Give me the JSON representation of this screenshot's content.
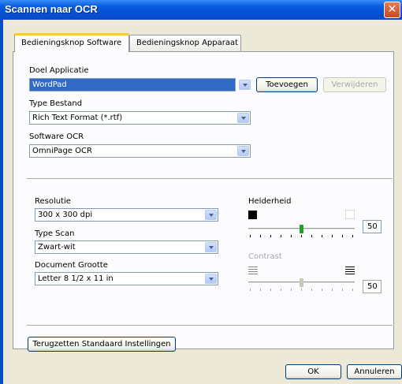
{
  "window": {
    "title": "Scannen naar OCR",
    "close_glyph": "✕"
  },
  "tabs": [
    {
      "label": "Bedieningsknop Software",
      "active": true
    },
    {
      "label": "Bedieningsknop Apparaat",
      "active": false
    }
  ],
  "app": {
    "label": "Doel Applicatie",
    "value": "WordPad",
    "add_label": "Toevoegen",
    "remove_label": "Verwijderen"
  },
  "file_type": {
    "label": "Type Bestand",
    "value": "Rich Text Format (*.rtf)"
  },
  "ocr": {
    "label": "Software OCR",
    "value": "OmniPage OCR"
  },
  "resolution": {
    "label": "Resolutie",
    "value": "300 x 300 dpi"
  },
  "scan_type": {
    "label": "Type Scan",
    "value": "Zwart-wit"
  },
  "doc_size": {
    "label": "Document Grootte",
    "value": "Letter 8 1/2 x 11 in"
  },
  "brightness": {
    "label": "Helderheid",
    "value": "50"
  },
  "contrast": {
    "label": "Contrast",
    "value": "50"
  },
  "reset_label": "Terugzetten Standaard Instellingen",
  "ok_label": "OK",
  "cancel_label": "Annuleren",
  "icons": {
    "close": "close-icon",
    "dropdown": "chevron-down-icon",
    "brightness_dark": "dark-square-icon",
    "brightness_light": "light-square-icon",
    "contrast_low": "low-contrast-icon",
    "contrast_high": "high-contrast-icon"
  },
  "colors": {
    "titlebar": "#0451d6",
    "active_tab_accent": "#ffc83c",
    "selection": "#316ac5",
    "slider_thumb": "#21a121"
  }
}
